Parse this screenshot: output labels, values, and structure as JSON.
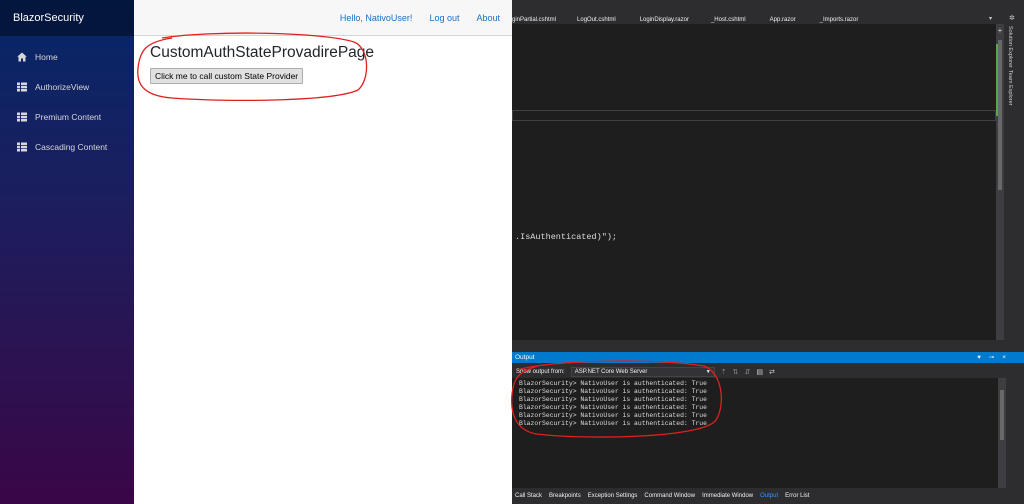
{
  "app": {
    "brand": "BlazorSecurity",
    "nav": [
      {
        "label": "Home",
        "icon": "home-icon"
      },
      {
        "label": "AuthorizeView",
        "icon": "list-icon"
      },
      {
        "label": "Premium Content",
        "icon": "list-icon"
      },
      {
        "label": "Cascading Content",
        "icon": "list-icon"
      }
    ],
    "top_links": {
      "hello": "Hello, NativoUser!",
      "logout": "Log out",
      "about": "About"
    },
    "page_title": "CustomAuthStateProvadirePage",
    "button_label": "Click me to call custom State Provider"
  },
  "vs": {
    "tabs": [
      "ginPartial.cshtml",
      "LogOut.cshtml",
      "LoginDisplay.razor",
      "_Host.cshtml",
      "App.razor",
      "_Imports.razor"
    ],
    "code_fragment": ".IsAuthenticated)\");",
    "side_tabs": [
      "Solution Explorer",
      "Team Explorer"
    ],
    "output": {
      "title": "Output",
      "show_from_label": "Show output from:",
      "source": "ASP.NET Core Web Server",
      "lines": [
        "BlazorSecurity> NativoUser is authenticated: True",
        "BlazorSecurity> NativoUser is authenticated: True",
        "BlazorSecurity> NativoUser is authenticated: True",
        "BlazorSecurity> NativoUser is authenticated: True",
        "BlazorSecurity> NativoUser is authenticated: True",
        "BlazorSecurity> NativoUser is authenticated: True"
      ]
    },
    "bottom_tabs": [
      "Call Stack",
      "Breakpoints",
      "Exception Settings",
      "Command Window",
      "Immediate Window",
      "Output",
      "Error List"
    ],
    "active_bottom_tab": "Output"
  },
  "colors": {
    "accent": "#007acc",
    "link": "#1b6ec2",
    "annotation": "#e02020"
  }
}
